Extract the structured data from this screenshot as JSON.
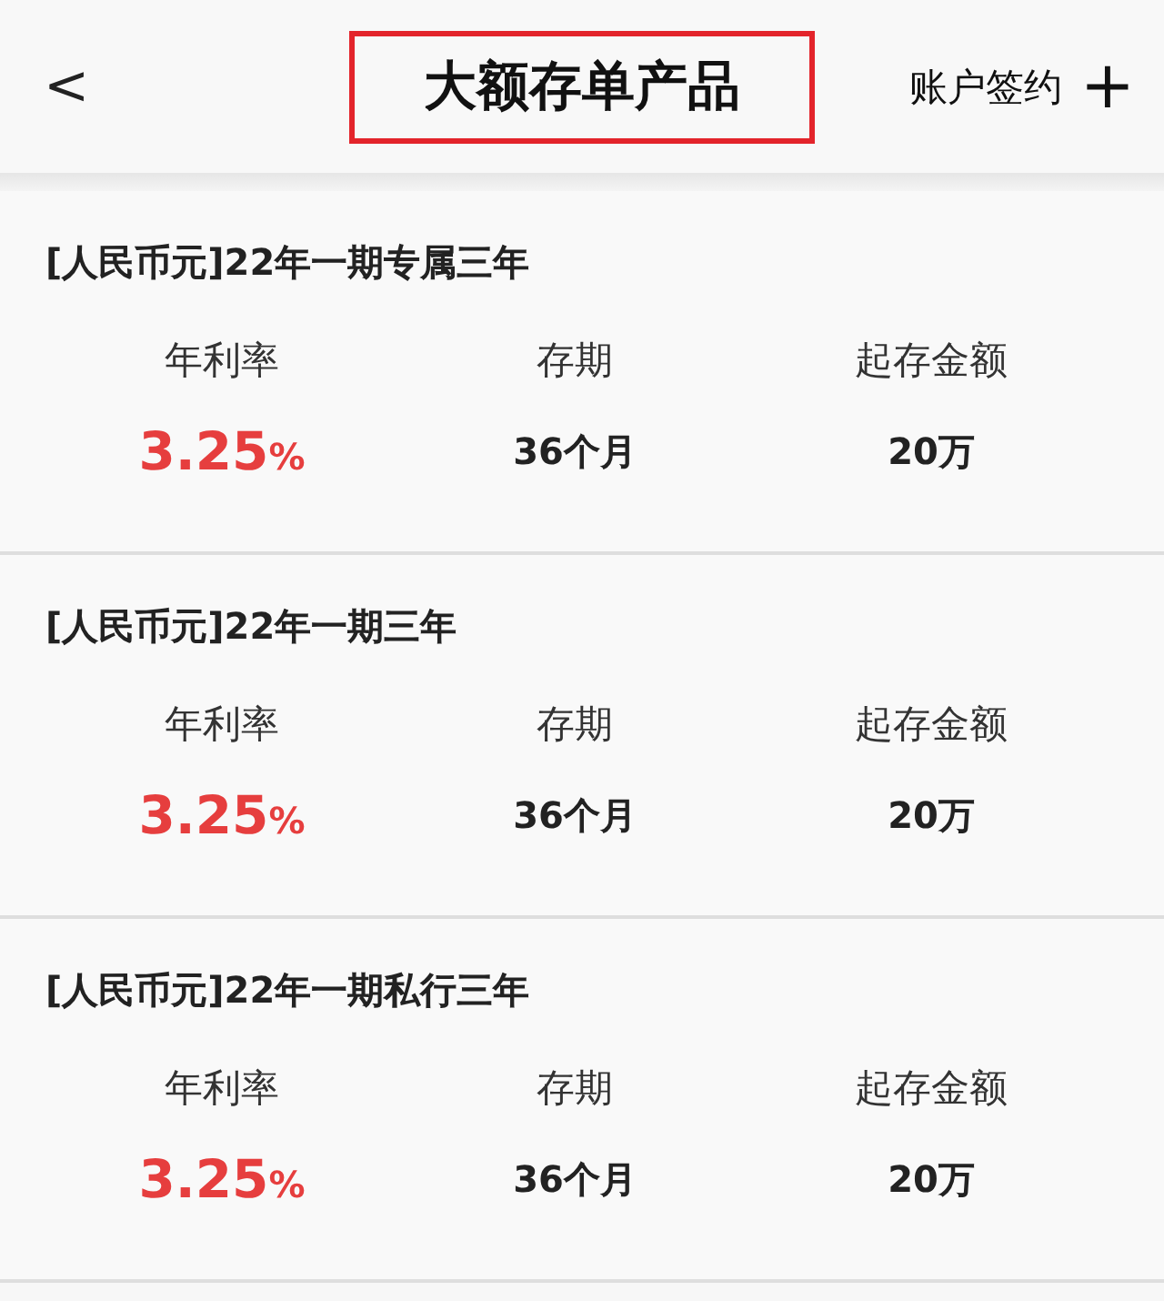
{
  "header": {
    "back_icon": "<",
    "title": "大额存单产品",
    "title_highlighted": true,
    "action": "账户签约",
    "add_icon": "+"
  },
  "products": [
    {
      "name": "[人民币元]22年一期专属三年",
      "rate_label": "年利率",
      "rate": "3.25",
      "rate_unit": "%",
      "term_label": "存期",
      "term": "36个月",
      "min_label": "起存金额",
      "min": "20万"
    },
    {
      "name": "[人民币元]22年一期三年",
      "rate_label": "年利率",
      "rate": "3.25",
      "rate_unit": "%",
      "term_label": "存期",
      "term": "36个月",
      "min_label": "起存金额",
      "min": "20万"
    },
    {
      "name": "[人民币元]22年一期私行三年",
      "rate_label": "年利率",
      "rate": "3.25",
      "rate_unit": "%",
      "term_label": "存期",
      "term": "36个月",
      "min_label": "起存金额",
      "min": "20万"
    }
  ]
}
